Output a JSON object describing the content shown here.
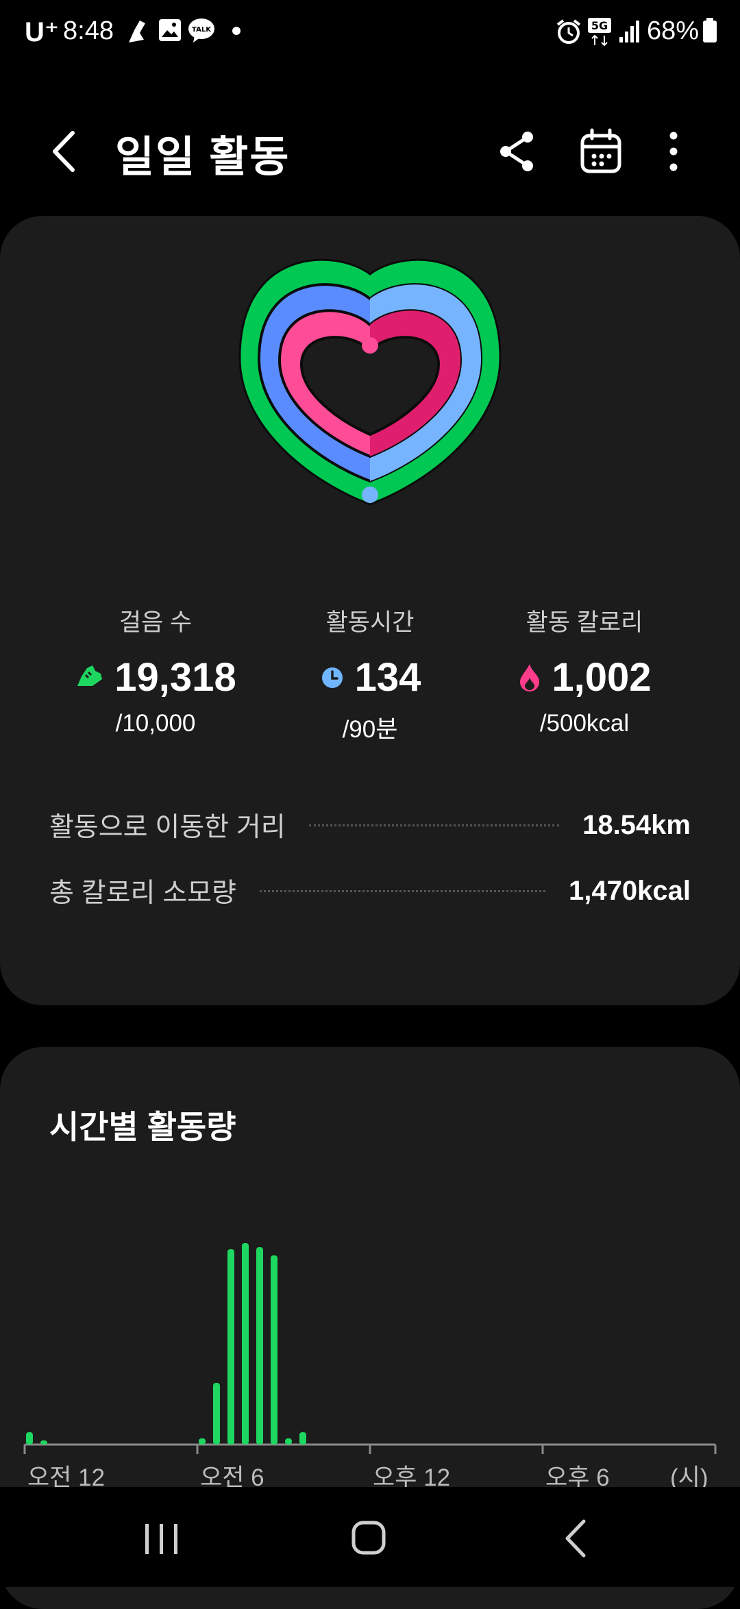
{
  "status_bar": {
    "carrier": "U⁺",
    "time": "8:48",
    "network": "5G",
    "battery": "68%"
  },
  "header": {
    "title": "일일 활동"
  },
  "summary": {
    "stats": [
      {
        "label": "걸음 수",
        "value": "19,318",
        "goal": "/10,000",
        "icon": "shoe-icon",
        "color": "#1ed760"
      },
      {
        "label": "활동시간",
        "value": "134",
        "goal": "/90분",
        "icon": "clock-icon",
        "color": "#6fb6ff"
      },
      {
        "label": "활동 칼로리",
        "value": "1,002",
        "goal": "/500kcal",
        "icon": "flame-icon",
        "color": "#ff3d8a"
      }
    ],
    "rows": [
      {
        "label": "활동으로 이동한 거리",
        "value": "18.54km"
      },
      {
        "label": "총 칼로리 소모량",
        "value": "1,470kcal"
      }
    ]
  },
  "chart_section": {
    "title": "시간별 활동량",
    "unit": "(시)"
  },
  "chart_data": {
    "type": "bar",
    "x": [
      0.0,
      1.0,
      12.0,
      13.0,
      14.0,
      15.0,
      16.0,
      17.0,
      18.0,
      19.0
    ],
    "values": [
      6,
      2,
      3,
      30,
      95,
      98,
      96,
      92,
      3,
      6
    ],
    "xlim": [
      0,
      48
    ],
    "ylim": [
      0,
      100
    ],
    "tick_positions": [
      0,
      12,
      24,
      36
    ],
    "tick_labels": [
      "오전 12",
      "오전 6",
      "오후 12",
      "오후 6"
    ],
    "bar_color": "#1ed760"
  },
  "colors": {
    "steps": "#1ed760",
    "active_time": "#5b8cff",
    "calories": "#ff3d8a",
    "card": "#1c1c1c"
  }
}
